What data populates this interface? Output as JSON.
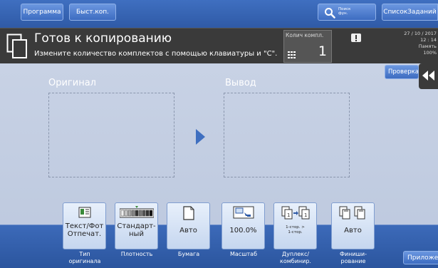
{
  "topbar": {
    "program_label": "Программа",
    "fast_copy_label": "Быст.коп.",
    "search_label": "Поиск\nфун.",
    "job_list_label": "СписокЗаданий"
  },
  "status": {
    "title": "Готов к копированию",
    "message": "Измените количество комплектов с помощью клавиатуры и \"С\".",
    "sets_label": "Колич компл.",
    "sets_value": "1",
    "date": "27 / 10 / 2017",
    "time": "12 : 14",
    "memory_label": "Память",
    "memory_value": "100%"
  },
  "main": {
    "original_label": "Оригинал",
    "output_label": "Вывод",
    "check_label": "Проверка"
  },
  "functions": [
    {
      "value": "Текст/Фот\nОтпечат.",
      "caption": "Тип\nоригинала",
      "icon": "text-photo-icon"
    },
    {
      "value": "Стандарт-\nный",
      "caption": "Плотность",
      "icon": "density-icon"
    },
    {
      "value": "Авто",
      "caption": "Бумага",
      "icon": "paper-icon"
    },
    {
      "value": "100.0%",
      "caption": "Масштаб",
      "icon": "zoom-icon"
    },
    {
      "value": "1-стор. >\n1-стор.",
      "caption": "Дуплекс/\nкомбинир.",
      "icon": "duplex-icon"
    },
    {
      "value": "Авто",
      "caption": "Финиши-\nрование",
      "icon": "finishing-icon"
    }
  ],
  "app_label": "Приложение",
  "colors": {
    "accent": "#3f6fc0",
    "background": "#c9d3e6",
    "status_bar": "#3a3a3a"
  }
}
